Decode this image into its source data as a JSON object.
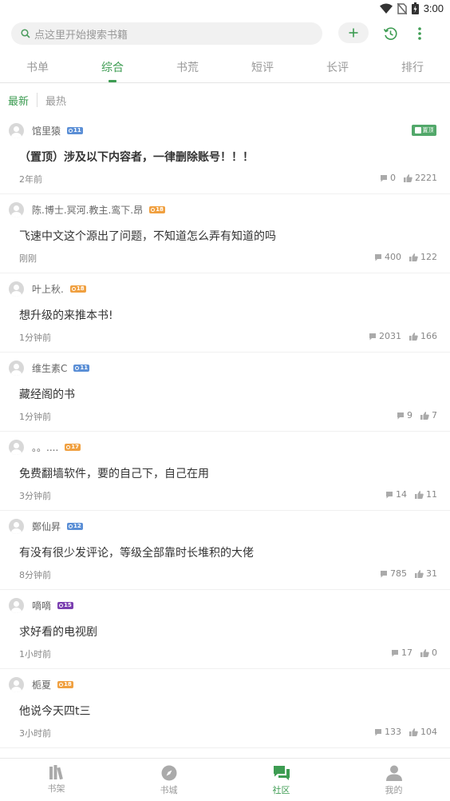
{
  "status_bar": {
    "time": "3:00"
  },
  "search": {
    "placeholder": "点这里开始搜索书籍"
  },
  "tabs": [
    {
      "label": "书单",
      "active": false
    },
    {
      "label": "综合",
      "active": true
    },
    {
      "label": "书荒",
      "active": false
    },
    {
      "label": "短评",
      "active": false
    },
    {
      "label": "长评",
      "active": false
    },
    {
      "label": "排行",
      "active": false
    }
  ],
  "sort": {
    "latest": "最新",
    "hottest": "最热"
  },
  "pin_label": "置顶",
  "posts": [
    {
      "user": "馆里猿",
      "level": "11",
      "badge_color": "#5b8fd6",
      "pinned": true,
      "content": "（置顶）涉及以下内容者，一律删除账号！！！",
      "time": "2年前",
      "comments": "0",
      "likes": "2221"
    },
    {
      "user": "陈.博士.冥河.教主.鸾下.昂",
      "level": "18",
      "badge_color": "#f0a040",
      "pinned": false,
      "content": "飞速中文这个源出了问题，不知道怎么弄有知道的吗",
      "time": "刚刚",
      "comments": "400",
      "likes": "122"
    },
    {
      "user": "叶上秋.",
      "level": "18",
      "badge_color": "#f0a040",
      "pinned": false,
      "content": "想升级的来推本书!",
      "time": "1分钟前",
      "comments": "2031",
      "likes": "166"
    },
    {
      "user": "维生素C",
      "level": "11",
      "badge_color": "#5b8fd6",
      "pinned": false,
      "content": "藏经阁的书",
      "time": "1分钟前",
      "comments": "9",
      "likes": "7"
    },
    {
      "user": "。。....",
      "level": "17",
      "badge_color": "#f0a040",
      "pinned": false,
      "content": "免费翻墙软件，要的自己下，自己在用",
      "time": "3分钟前",
      "comments": "14",
      "likes": "11"
    },
    {
      "user": "鄭仙昇",
      "level": "12",
      "badge_color": "#5b8fd6",
      "pinned": false,
      "content": "有没有很少发评论，等级全部靠时长堆积的大佬",
      "time": "8分钟前",
      "comments": "785",
      "likes": "31"
    },
    {
      "user": "嘀嘀",
      "level": "15",
      "badge_color": "#7a3fb0",
      "pinned": false,
      "content": "求好看的电视剧",
      "time": "1小时前",
      "comments": "17",
      "likes": "0"
    },
    {
      "user": "栀夏",
      "level": "18",
      "badge_color": "#f0a040",
      "pinned": false,
      "content": "他说今天四t三",
      "time": "3小时前",
      "comments": "133",
      "likes": "104"
    }
  ],
  "nav": [
    {
      "label": "书架",
      "icon": "bookshelf-icon",
      "active": false
    },
    {
      "label": "书城",
      "icon": "compass-icon",
      "active": false
    },
    {
      "label": "社区",
      "icon": "chat-icon",
      "active": true
    },
    {
      "label": "我的",
      "icon": "person-icon",
      "active": false
    }
  ],
  "colors": {
    "accent": "#3d9c52"
  }
}
